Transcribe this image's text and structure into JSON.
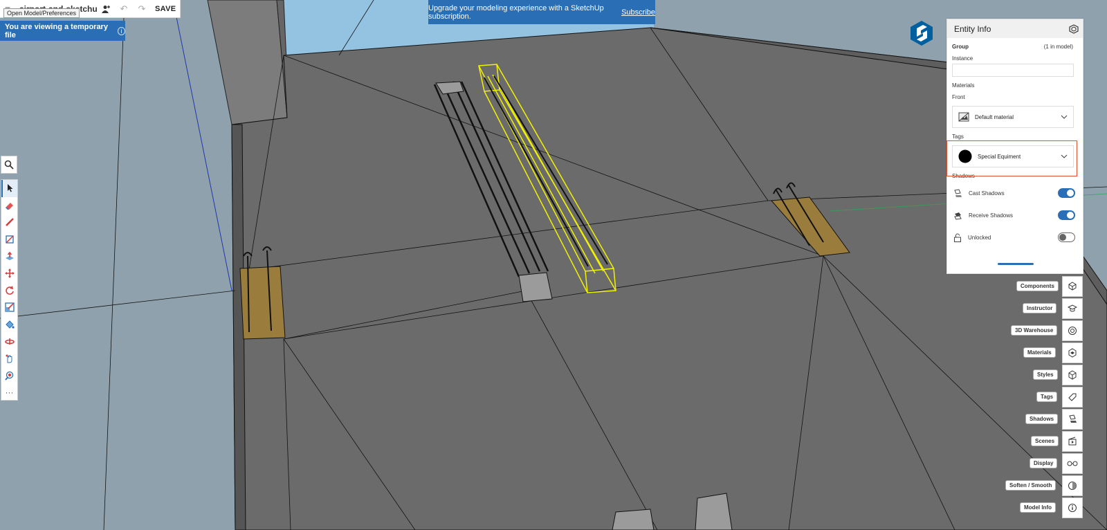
{
  "header": {
    "file_name": "airport-and-sketchup",
    "save_label": "SAVE",
    "tooltip": "Open Model/Preferences"
  },
  "temp_notice": {
    "text": "You are viewing a temporary file"
  },
  "banner": {
    "text": "Upgrade your modeling experience with a SketchUp subscription.",
    "link": "Subscribe"
  },
  "left_toolbar": {
    "tools": [
      "search-icon",
      "select-icon",
      "eraser-icon",
      "pencil-icon",
      "line-icon",
      "push-pull-icon",
      "move-icon",
      "rotate-icon",
      "scale-icon",
      "paint-bucket-icon",
      "orbit-icon",
      "pan-icon",
      "zoom-extents-icon",
      "more-icon"
    ]
  },
  "entity_info": {
    "title": "Entity Info",
    "entity_type": "Group",
    "count": "(1 in model)",
    "instance_label": "Instance",
    "instance_value": "",
    "materials_label": "Materials",
    "front_label": "Front",
    "front_material": "Default material",
    "tags_label": "Tags",
    "tag_value": "Special Equiment",
    "shadows_label": "Shadows",
    "cast_shadows": {
      "label": "Cast Shadows",
      "on": true
    },
    "receive_shadows": {
      "label": "Receive Shadows",
      "on": true
    },
    "unlocked": {
      "label": "Unlocked",
      "on": false
    }
  },
  "right_tray": [
    {
      "label": "Components",
      "icon": "components-icon"
    },
    {
      "label": "Instructor",
      "icon": "instructor-icon"
    },
    {
      "label": "3D Warehouse",
      "icon": "warehouse-icon"
    },
    {
      "label": "Materials",
      "icon": "materials-icon"
    },
    {
      "label": "Styles",
      "icon": "styles-icon"
    },
    {
      "label": "Tags",
      "icon": "tags-icon"
    },
    {
      "label": "Shadows",
      "icon": "shadows-icon"
    },
    {
      "label": "Scenes",
      "icon": "scenes-icon"
    },
    {
      "label": "Display",
      "icon": "display-icon"
    },
    {
      "label": "Soften / Smooth",
      "icon": "soften-icon"
    },
    {
      "label": "Model Info",
      "icon": "info-icon"
    }
  ],
  "colors": {
    "accent": "#2a6fb5",
    "highlight": "#e0532c",
    "selection": "#f2f200",
    "floor": "#6b6b6b",
    "sky": "#8fb9d8"
  }
}
